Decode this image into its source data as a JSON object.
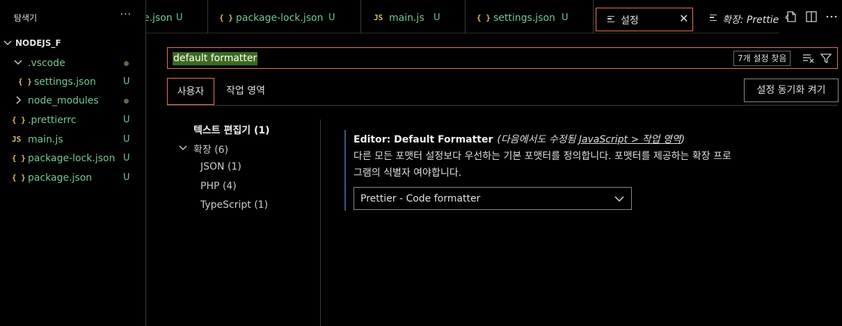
{
  "sidebar": {
    "title": "탐색기",
    "more": "···",
    "root": "NODEJS_F",
    "items": [
      {
        "label": ".vscode",
        "status": "",
        "icon": "folder-chevron-down"
      },
      {
        "label": "settings.json",
        "status": "U",
        "icon": "{ }"
      },
      {
        "label": "node_modules",
        "status": "",
        "icon": "folder-chevron-right"
      },
      {
        "label": ".prettierrc",
        "status": "U",
        "icon": "{ }"
      },
      {
        "label": "main.js",
        "status": "U",
        "icon": "JS"
      },
      {
        "label": "package-lock.json",
        "status": "U",
        "icon": "{ }"
      },
      {
        "label": "package.json",
        "status": "U",
        "icon": "{ }"
      }
    ]
  },
  "tabs": [
    {
      "label": "e.json",
      "status": "U",
      "icon": ""
    },
    {
      "label": "package-lock.json",
      "status": "U",
      "icon": "{ }"
    },
    {
      "label": "main.js",
      "status": "U",
      "icon": "JS"
    },
    {
      "label": "settings.json",
      "status": "U",
      "icon": "{ }"
    },
    {
      "label": "설정",
      "icon": "settings-lines-icon",
      "close": "✕"
    },
    {
      "label": "확장: Prettie",
      "icon": "settings-lines-icon"
    }
  ],
  "search": {
    "query": "default formatter",
    "found": "7개 설정 찾음"
  },
  "scope": {
    "user": "사용자",
    "workspace": "작업 영역",
    "sync": "설정 동기화 켜기"
  },
  "toc": {
    "text_editor": "텍스트 편집기 (1)",
    "extensions": "확장 (6)",
    "json": "JSON (1)",
    "php": "PHP (4)",
    "typescript": "TypeScript (1)"
  },
  "setting": {
    "title": "Editor: Default Formatter",
    "modified_prefix": "(다음에서도 수정됨 ",
    "modified_link": "JavaScript > 작업 영역",
    "modified_suffix": ")",
    "desc1": "다른 모든 포맷터 설정보다 우선하는 기본 포맷터를 정의합니다. 포맷터를 제공하는 확장 프로",
    "desc2": "그램의 식별자 여야합니다.",
    "value": "Prettier - Code formatter"
  },
  "colors": {
    "accent": "#e7775c",
    "untracked": "#73c991",
    "json_icon": "#e2c05c",
    "search_highlight": "#3d6b1f"
  }
}
